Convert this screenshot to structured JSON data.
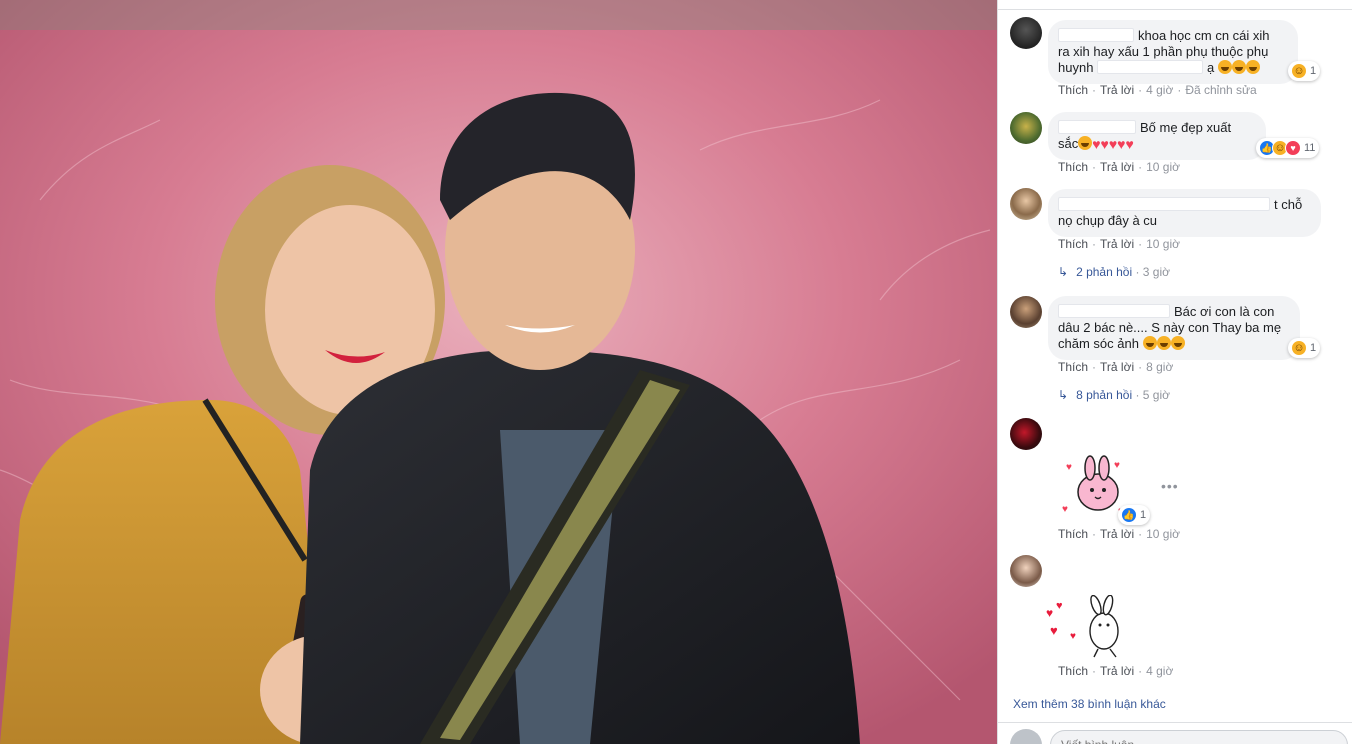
{
  "comments": [
    {
      "text_lines": [
        "khoa học cm cn cái xih",
        "ra xih hay xấu 1 phần phụ thuộc phụ",
        "huynh",
        "ạ"
      ],
      "reactions": {
        "count": "1",
        "icons": [
          "haha-icon"
        ]
      },
      "actions": {
        "like": "Thích",
        "reply": "Trả lời",
        "time": "4 giờ",
        "edited": "Đã chỉnh sửa"
      }
    },
    {
      "text_lines": [
        "Bố mẹ đẹp xuất",
        "sắc"
      ],
      "reactions": {
        "count": "11",
        "icons": [
          "like-icon",
          "haha-icon",
          "love-icon"
        ]
      },
      "actions": {
        "like": "Thích",
        "reply": "Trả lời",
        "time": "10 giờ"
      }
    },
    {
      "text_lines": [
        "t chỗ",
        "nọ chụp đây à cu"
      ],
      "actions": {
        "like": "Thích",
        "reply": "Trả lời",
        "time": "10 giờ"
      },
      "replies": {
        "label": "2 phản hồi",
        "time": "3 giờ"
      }
    },
    {
      "text_lines": [
        "Bác ơi con là con",
        "dâu 2 bác nè.... S này con Thay ba mẹ",
        "chăm sóc ảnh"
      ],
      "reactions": {
        "count": "1",
        "icons": [
          "haha-icon"
        ]
      },
      "actions": {
        "like": "Thích",
        "reply": "Trả lời",
        "time": "8 giờ"
      },
      "replies": {
        "label": "8 phản hồi",
        "time": "5 giờ"
      }
    },
    {
      "sticker": "bunny-hearts-sticker",
      "reactions": {
        "count": "1",
        "icons": [
          "like-icon"
        ]
      },
      "actions": {
        "like": "Thích",
        "reply": "Trả lời",
        "time": "10 giờ"
      }
    },
    {
      "sticker": "rabbit-hearts-sticker",
      "actions": {
        "like": "Thích",
        "reply": "Trả lời",
        "time": "4 giờ"
      }
    }
  ],
  "view_more": "Xem thêm 38 bình luận khác",
  "composer": {
    "placeholder": "Viết bình luận..."
  },
  "colors": {
    "link": "#385898",
    "meta": "#90949c",
    "bubble": "#f2f3f5",
    "photo_bg": "#d98196"
  }
}
